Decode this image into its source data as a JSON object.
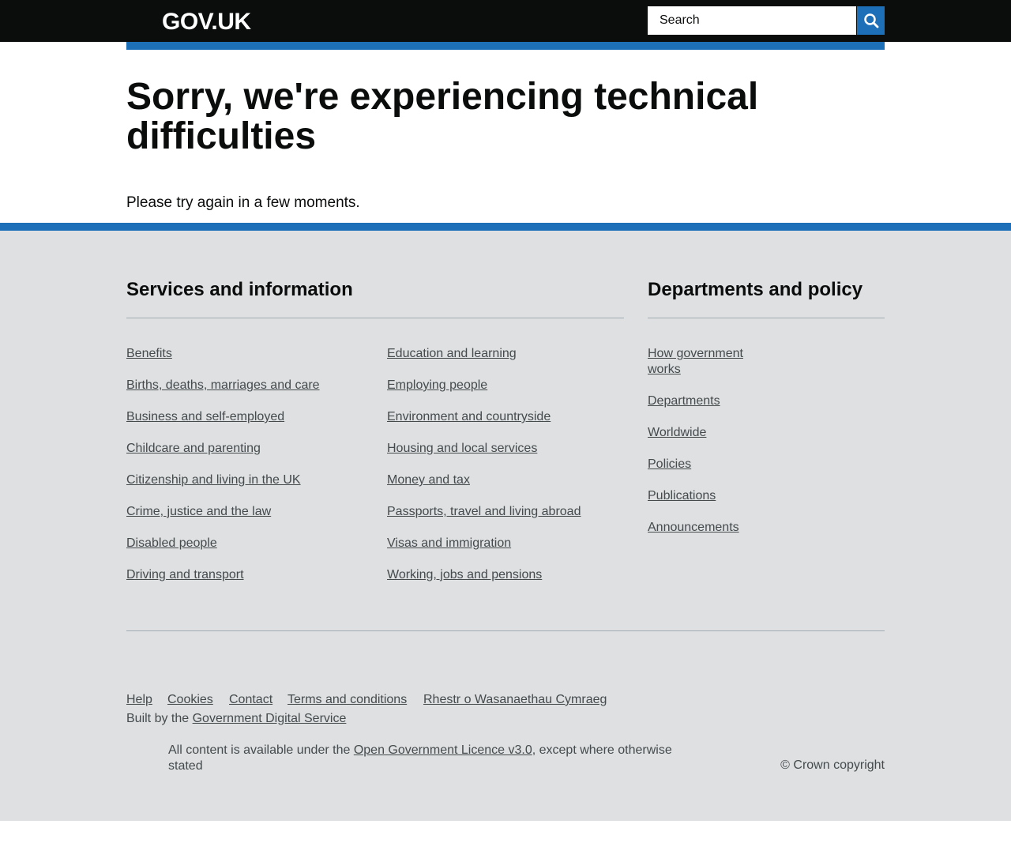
{
  "header": {
    "logo": "GOV.UK",
    "search_placeholder": "Search",
    "search_icon": "search-icon"
  },
  "main": {
    "title": "Sorry, we're experiencing technical difficulties",
    "body": "Please try again in a few moments."
  },
  "colors": {
    "header_bg": "#0b0c0c",
    "accent": "#1d70b8",
    "footer_bg": "#dee0e2",
    "link_text": "#454a4c"
  },
  "footer": {
    "services": {
      "heading": "Services and information",
      "col1": [
        "Benefits",
        "Births, deaths, marriages and care",
        "Business and self-employed",
        "Childcare and parenting",
        "Citizenship and living in the UK",
        "Crime, justice and the law",
        "Disabled people",
        "Driving and transport"
      ],
      "col2": [
        "Education and learning",
        "Employing people",
        "Environment and countryside",
        "Housing and local services",
        "Money and tax",
        "Passports, travel and living abroad",
        "Visas and immigration",
        "Working, jobs and pensions"
      ]
    },
    "departments": {
      "heading": "Departments and policy",
      "links": [
        "How government works",
        "Departments",
        "Worldwide",
        "Policies",
        "Publications",
        "Announcements"
      ]
    },
    "meta_links": [
      "Help",
      "Cookies",
      "Contact",
      "Terms and conditions",
      "Rhestr o Wasanaethau Cymraeg"
    ],
    "built_by_prefix": "Built by the",
    "built_by_link": "Government Digital Service",
    "licence_prefix": "All content is available under the",
    "licence_link": "Open Government Licence v3.0",
    "licence_suffix": ", except where otherwise stated",
    "copyright": "© Crown copyright"
  }
}
